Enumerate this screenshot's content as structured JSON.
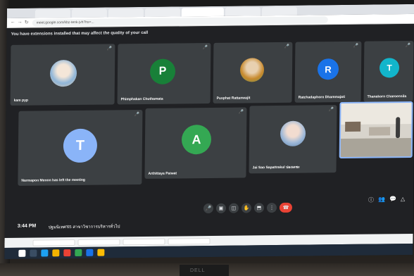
{
  "browser": {
    "tabs": [
      "",
      "",
      "",
      "",
      "",
      "",
      ""
    ],
    "address": "meet.google.com/kbz-tenk-jvh?hs=..."
  },
  "meet": {
    "banner": "You have extensions installed that may affect the quality of your call",
    "banner_link": "",
    "participants": [
      {
        "name": "kam pyp",
        "initial": "",
        "color": "#3c4043"
      },
      {
        "name": "Phimphakan Chuthamata",
        "initial": "P",
        "color": "#188038"
      },
      {
        "name": "Pusphat Rattanwajit",
        "initial": "",
        "color": "#3c4043"
      },
      {
        "name": "Ratchadaphorn Dhammajati",
        "initial": "R",
        "color": "#1a73e8"
      },
      {
        "name": "Thanakorn Charoensila",
        "initial": "T",
        "color": "#12b5cb"
      },
      {
        "name": "Narmapon Menon has left the meeting",
        "initial": "T",
        "color": "#8ab4f8"
      },
      {
        "name": "Arthittaya Paiwat",
        "initial": "A",
        "color": "#34a853"
      },
      {
        "name": "Jai Sao Sapattrakul ปองเดชะ",
        "initial": "",
        "color": "#3c4043"
      },
      {
        "name": "",
        "initial": "",
        "color": ""
      }
    ],
    "time": "3:44 PM",
    "meeting_title": "ปฐมนิเทศ'65 สาขาวิชาการบริหารทั่วไป"
  },
  "icons": {
    "mic": "🎤",
    "cam": "▣",
    "cc": "◫",
    "hand": "✋",
    "present": "⬒",
    "more": "⋮",
    "end": "☎",
    "info": "ⓘ",
    "people": "👥",
    "chat": "💬",
    "activities": "△"
  },
  "taskbar": {
    "logo": "DELL"
  }
}
